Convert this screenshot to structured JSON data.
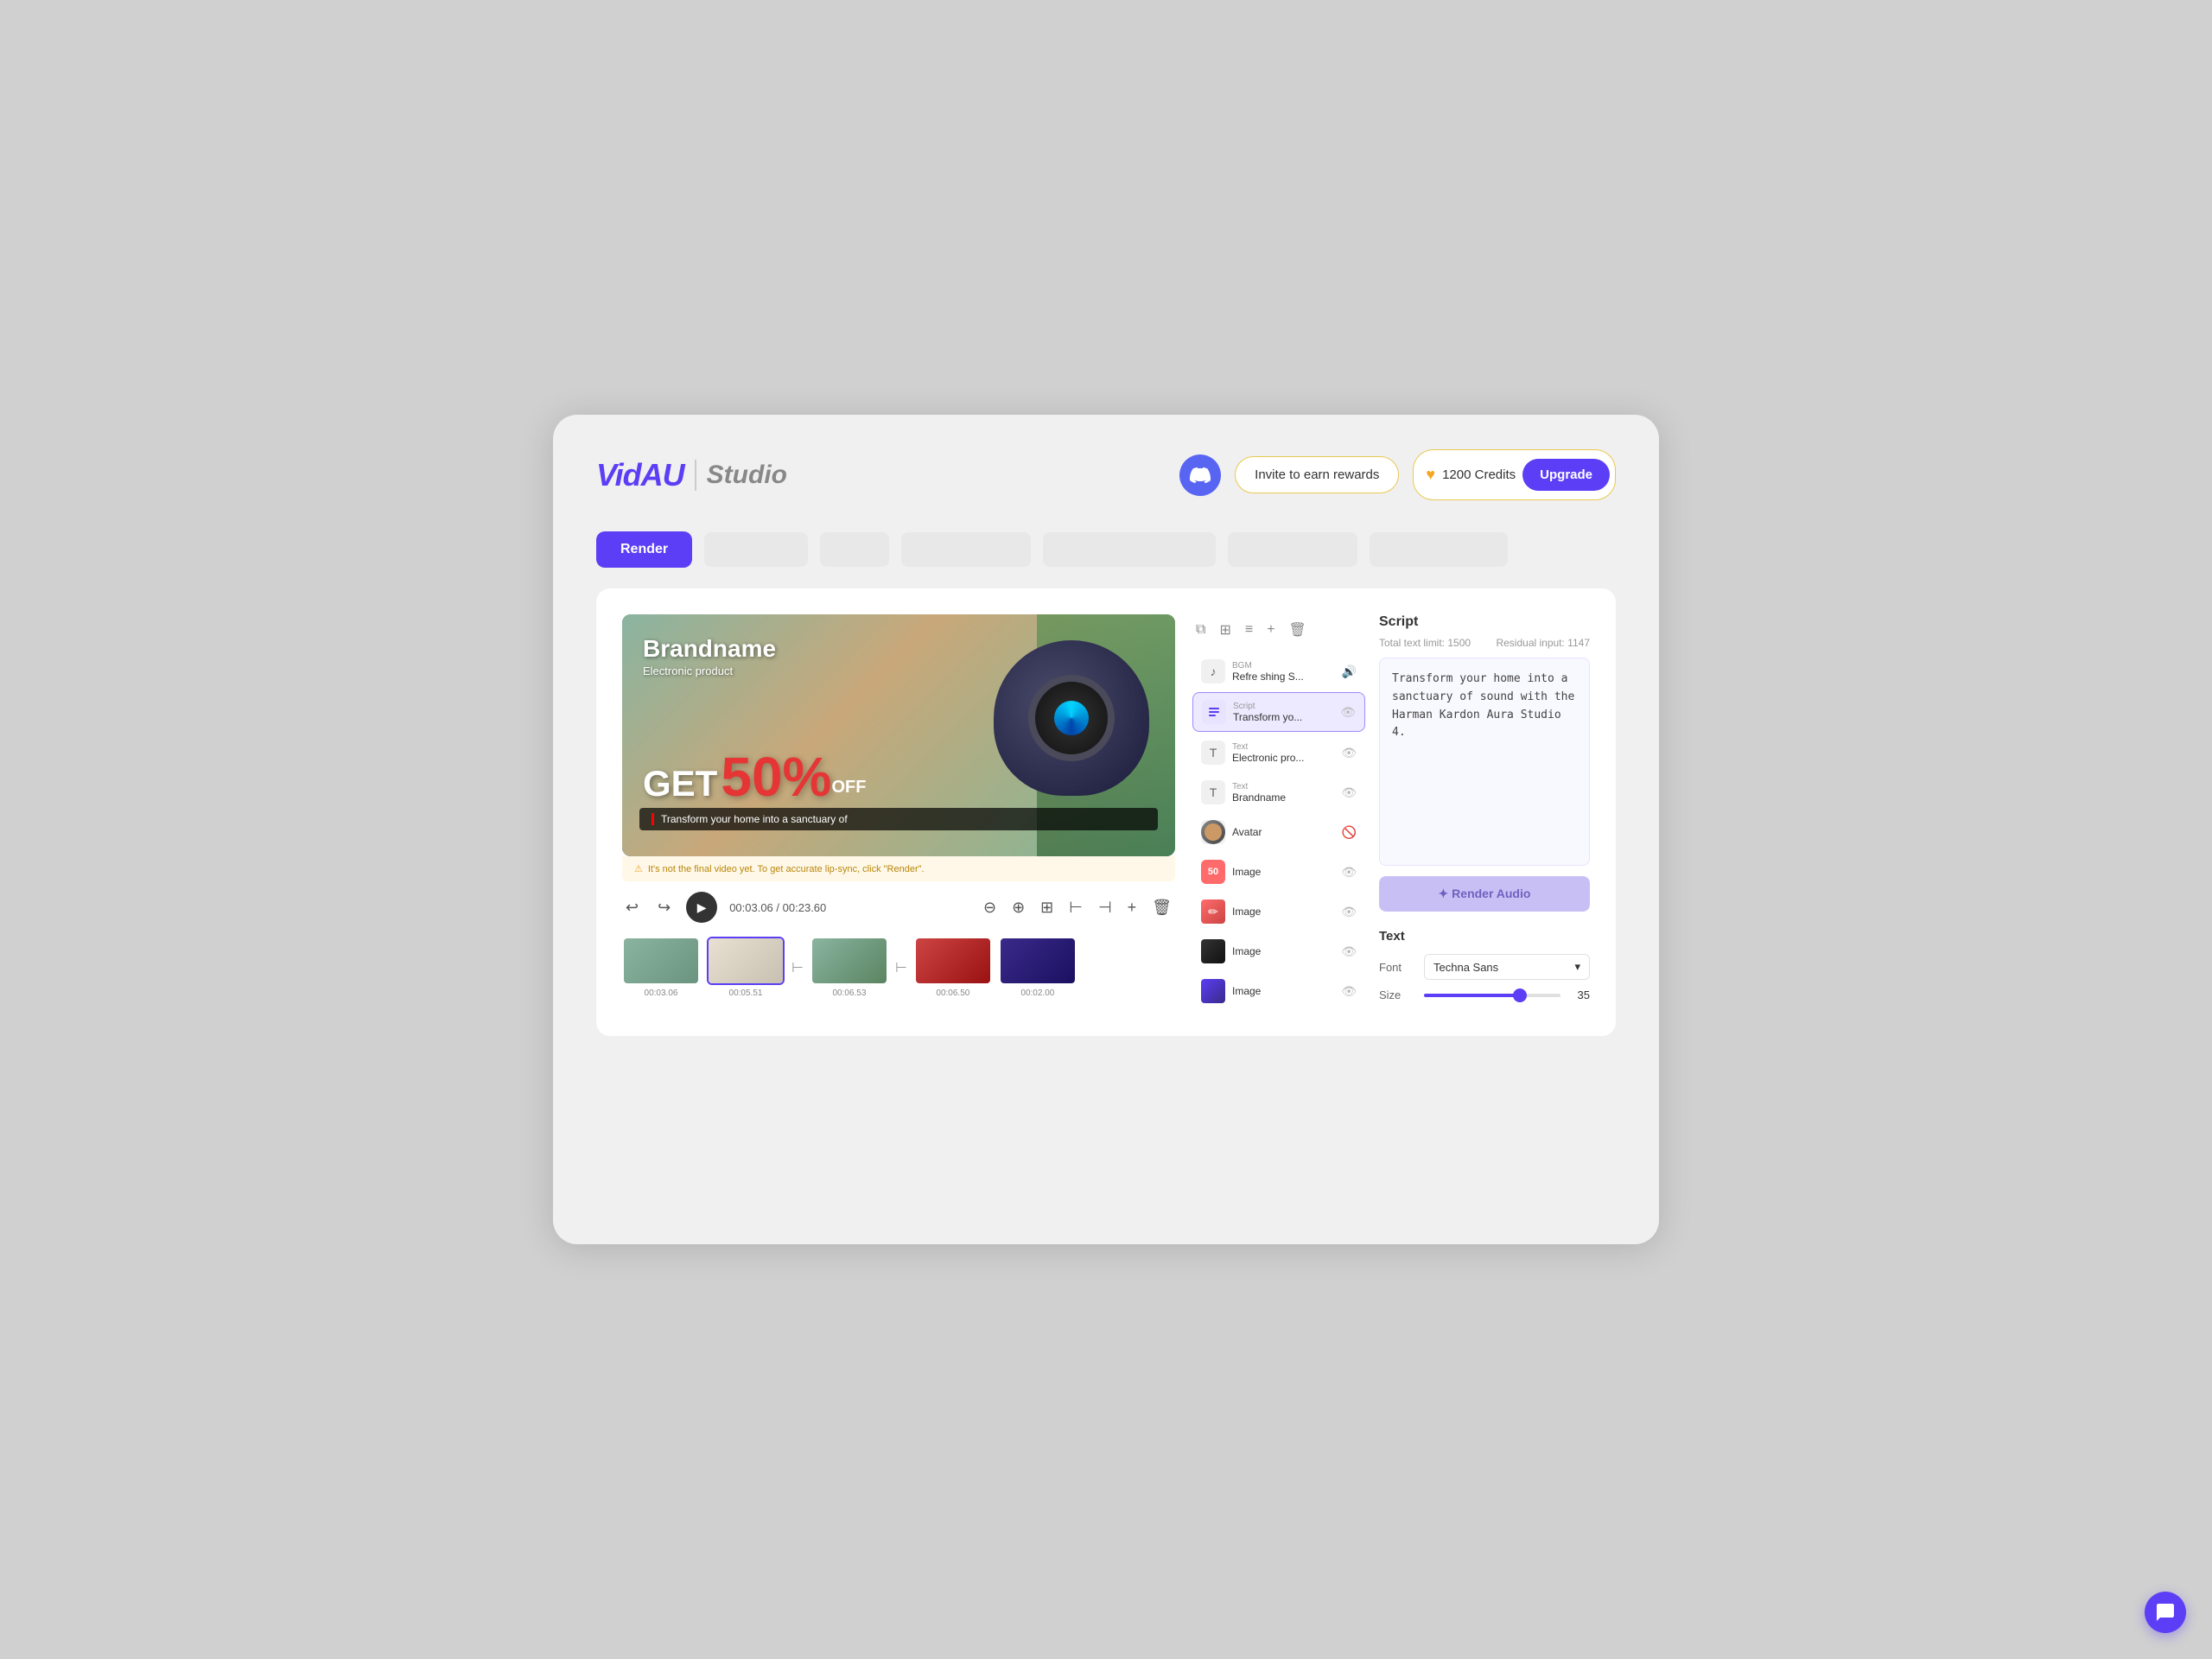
{
  "app": {
    "logo": "VidAU",
    "subtitle": "Studio"
  },
  "header": {
    "discord_label": "🎮",
    "invite_label": "Invite to earn rewards",
    "credits_icon": "♥",
    "credits_count": "1200 Credits",
    "upgrade_label": "Upgrade"
  },
  "toolbar": {
    "render_label": "Render",
    "tabs": [
      "",
      "",
      "",
      "",
      "",
      ""
    ]
  },
  "video": {
    "brand": "Brandname",
    "product": "Electronic product",
    "get_text": "GET",
    "discount": "50%",
    "off": "OFF",
    "caption": "Transform your home into a sanctuary of",
    "warning": "It's not the final video yet. To get accurate lip-sync, click \"Render\".",
    "current_time": "00:03.06",
    "total_time": "00:23.60"
  },
  "timeline": {
    "items": [
      {
        "time": "00:03.06",
        "active": false
      },
      {
        "time": "00:05.51",
        "active": true
      },
      {
        "time": "00:06.53",
        "active": false
      },
      {
        "time": "00:06.50",
        "active": false
      },
      {
        "time": "00:02.00",
        "active": false
      }
    ]
  },
  "layers": {
    "toolbar_icons": [
      "copy",
      "align",
      "layers",
      "add",
      "delete"
    ],
    "items": [
      {
        "type": "BGM",
        "name": "Refre shing S...",
        "icon_type": "bgm",
        "icon": "♪",
        "eye": "👁",
        "has_sound": true
      },
      {
        "type": "Script",
        "name": "Transform yo...",
        "icon_type": "script",
        "icon": "≡",
        "eye": "👁",
        "active": true
      },
      {
        "type": "Text",
        "name": "Electronic pro...",
        "icon_type": "text-layer",
        "icon": "T",
        "eye": "👁"
      },
      {
        "type": "Text",
        "name": "Brandname",
        "icon_type": "text-layer",
        "icon": "T",
        "eye": "👁"
      },
      {
        "type": "",
        "name": "Avatar",
        "icon_type": "avatar",
        "icon": "",
        "eye": "🚫"
      },
      {
        "type": "",
        "name": "Image",
        "icon_type": "image-50",
        "icon": "50",
        "eye": "👁"
      },
      {
        "type": "",
        "name": "Image",
        "icon_type": "image-brush",
        "icon": "🖌",
        "eye": "👁"
      },
      {
        "type": "",
        "name": "Image",
        "icon_type": "image-dark",
        "icon": "",
        "eye": "👁"
      },
      {
        "type": "",
        "name": "Image",
        "icon_type": "image-gradient",
        "icon": "",
        "eye": "👁"
      }
    ]
  },
  "script": {
    "title": "Script",
    "limit_label": "Total text limit: 1500",
    "residual_label": "Residual input: 1147",
    "content": "Transform your home into a sanctuary of sound with the Harman Kardon Aura Studio 4.",
    "render_audio_label": "✦ Render Audio"
  },
  "text_props": {
    "title": "Text",
    "font_label": "Font",
    "font_value": "Techna Sans",
    "size_label": "Size",
    "size_value": "35"
  }
}
